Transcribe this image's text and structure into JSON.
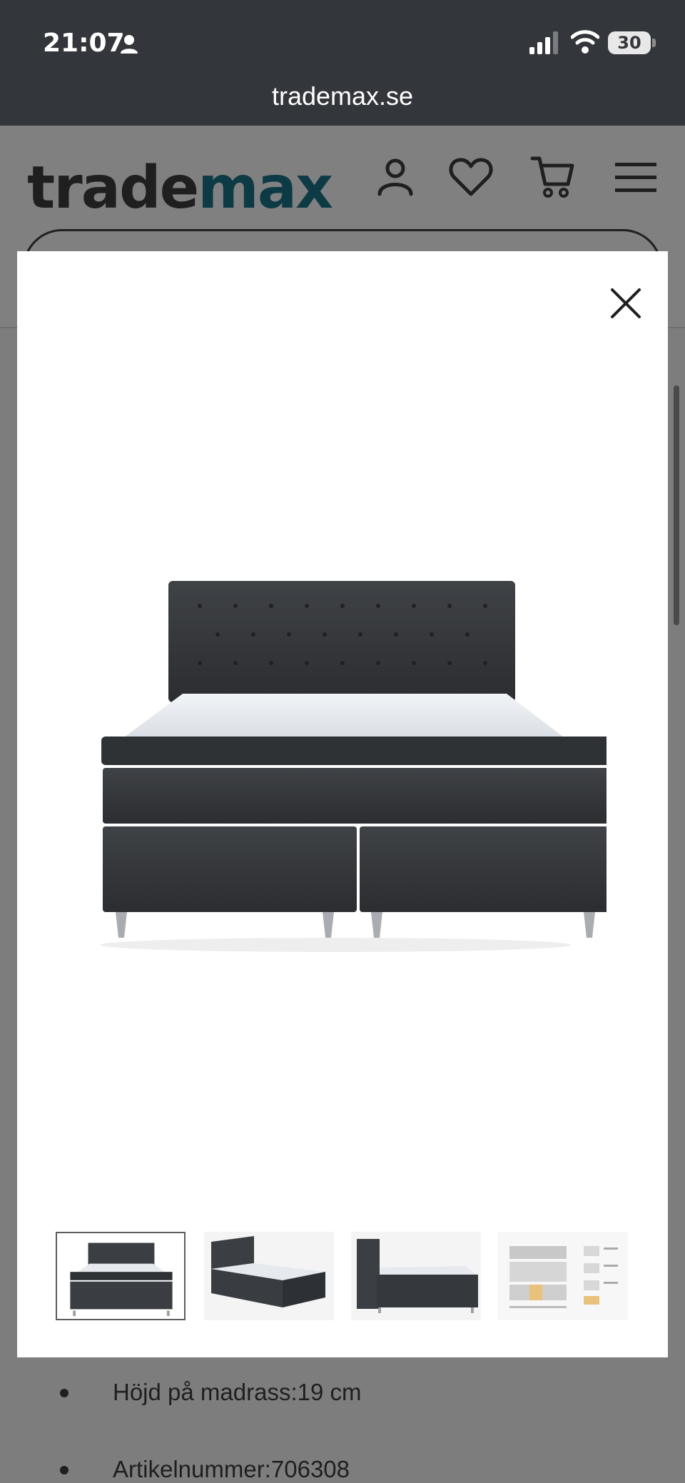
{
  "status_bar": {
    "time": "21:07",
    "battery": "30"
  },
  "browser": {
    "url": "trademax.se"
  },
  "site": {
    "logo_part1": "trade",
    "logo_part2": "max",
    "accent_color": "#0c3a45"
  },
  "modal": {
    "image_alt": "Kontinentalsäng",
    "thumbnails": [
      {
        "name": "thumb-front"
      },
      {
        "name": "thumb-angled"
      },
      {
        "name": "thumb-side"
      },
      {
        "name": "thumb-diagram"
      }
    ],
    "selected_thumbnail_index": 0
  },
  "specs": [
    "Höjd på madrass:19 cm",
    "Artikelnummer:706308"
  ],
  "icons": [
    "person-icon",
    "signal-icon",
    "wifi-icon",
    "account-icon",
    "heart-icon",
    "cart-icon",
    "menu-icon",
    "close-icon"
  ]
}
